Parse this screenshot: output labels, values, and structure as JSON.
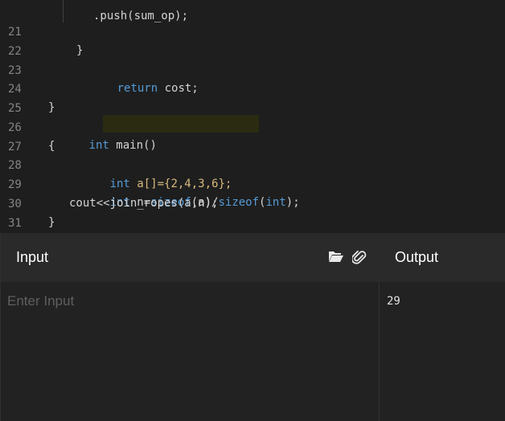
{
  "editor": {
    "lines": [
      {
        "num": "21",
        "code": "}"
      },
      {
        "num": "22",
        "kw": "return",
        "rest": " cost;"
      },
      {
        "num": "23"
      },
      {
        "num": "24",
        "code": "}"
      },
      {
        "num": "25",
        "kw": "int",
        "rest": " main()"
      },
      {
        "num": "26",
        "code": "{"
      },
      {
        "num": "27",
        "kw": "int",
        "rest": " a[]={2,4,3,6};"
      },
      {
        "num": "28",
        "kw": "int",
        "mid1": " n=",
        "kw2": "sizeof",
        "mid2": "(a)/",
        "kw3": "sizeof",
        "mid3": "(",
        "kw4": "int",
        "mid4": ");"
      },
      {
        "num": "29",
        "code": "cout<<join_ropes(a,n);"
      },
      {
        "num": "30",
        "code": "}"
      },
      {
        "num": "31"
      }
    ]
  },
  "panel": {
    "input_title": "Input",
    "output_title": "Output",
    "input_placeholder": "Enter Input",
    "output_value": "29"
  },
  "icons": {
    "open": "folder-open-icon",
    "attach": "paperclip-icon"
  },
  "colors": {
    "background": "#1e1e1e",
    "keyword": "#569cd6",
    "highlight": "#d7ba7d"
  }
}
